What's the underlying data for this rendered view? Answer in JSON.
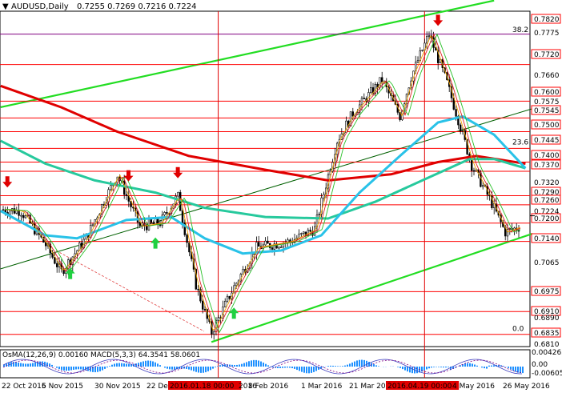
{
  "header": {
    "symbol_timeframe": "AUDUSD,Daily",
    "ohlc": "0.7255 0.7269 0.7216 0.7224"
  },
  "indicator_header": "OsMA(12,26,9) 0.00160 MACD(5,3,3) 64.3541 58.0601",
  "fib_labels": [
    {
      "text": "38.2",
      "price": 0.7822
    },
    {
      "text": "23.6",
      "price": 0.7452
    },
    {
      "text": "0.0",
      "price": 0.6841
    }
  ],
  "price_labels": [
    {
      "text": "0.7820",
      "boxed": true
    },
    {
      "text": "0.7775",
      "boxed": false
    },
    {
      "text": "0.7720",
      "boxed": true
    },
    {
      "text": "0.7660",
      "boxed": false
    },
    {
      "text": "0.7600",
      "boxed": true
    },
    {
      "text": "0.7575",
      "boxed": false
    },
    {
      "text": "0.7545",
      "boxed": true
    },
    {
      "text": "0.7500",
      "boxed": true
    },
    {
      "text": "0.7445",
      "boxed": true
    },
    {
      "text": "0.7400",
      "boxed": true
    },
    {
      "text": "0.7370",
      "boxed": true
    },
    {
      "text": "0.7320",
      "boxed": false
    },
    {
      "text": "0.7290",
      "boxed": true
    },
    {
      "text": "0.7260",
      "boxed": true
    },
    {
      "text": "0.7224",
      "boxed": false
    },
    {
      "text": "0.7200",
      "boxed": true
    },
    {
      "text": "0.7140",
      "boxed": true
    },
    {
      "text": "0.7065",
      "boxed": false
    },
    {
      "text": "0.6975",
      "boxed": true
    },
    {
      "text": "0.6910",
      "boxed": true
    },
    {
      "text": "0.6890",
      "boxed": false
    },
    {
      "text": "0.6835",
      "boxed": true
    },
    {
      "text": "0.6810",
      "boxed": false
    }
  ],
  "indicator_labels": [
    "0.004263",
    "0.00",
    "-0.00605"
  ],
  "date_labels": [
    "22 Oct 2015",
    "6 Nov 2015",
    "30 Nov 2015",
    "22 Dec 2015",
    "2016.01.18 00:00",
    "2016",
    "8 Feb 2016",
    "1 Mar 2016",
    "21 Mar 2016",
    "2016.04.19 00:00",
    "4 May 2016",
    "26 May 2016"
  ],
  "date_labels_highlighted": [
    "2016.01.18 00:00",
    "2016.04.19 00:00"
  ],
  "colors": {
    "sma200": "#e00000",
    "sma144": "#27c99d",
    "sma50": "#29c2e8",
    "fast_ma": "#e02020",
    "mid_ma": "#f0a000",
    "slow_ma": "#28c028",
    "channel": "#22dd22",
    "level_line": "#ff0000",
    "fib_line": "#800080",
    "arrow_down": "#e00000",
    "arrow_up": "#20d040",
    "osma": "#1e90ff",
    "macd_signal": "#4040c0",
    "highlight_box": "#e00000"
  },
  "chart_data": {
    "type": "candlestick",
    "symbol": "AUDUSD",
    "timeframe": "Daily",
    "last_bar": {
      "open": 0.7255,
      "high": 0.7269,
      "low": 0.7216,
      "close": 0.7224
    },
    "ylim": [
      0.6795,
      0.7895
    ],
    "horizontal_levels": [
      0.782,
      0.772,
      0.76,
      0.7545,
      0.75,
      0.7445,
      0.74,
      0.737,
      0.729,
      0.726,
      0.72,
      0.714,
      0.6975,
      0.691,
      0.6835
    ],
    "current_price": 0.7224,
    "swing_path": [
      {
        "date": "2015-10-13",
        "price": 0.7245
      },
      {
        "date": "2015-10-22",
        "price": 0.724
      },
      {
        "date": "2015-11-02",
        "price": 0.713
      },
      {
        "date": "2015-11-09",
        "price": 0.704
      },
      {
        "date": "2015-11-20",
        "price": 0.715
      },
      {
        "date": "2015-12-04",
        "price": 0.736
      },
      {
        "date": "2015-12-14",
        "price": 0.719
      },
      {
        "date": "2015-12-23",
        "price": 0.72
      },
      {
        "date": "2015-12-31",
        "price": 0.729
      },
      {
        "date": "2016-01-08",
        "price": 0.7
      },
      {
        "date": "2016-01-15",
        "price": 0.684
      },
      {
        "date": "2016-01-25",
        "price": 0.699
      },
      {
        "date": "2016-02-04",
        "price": 0.712
      },
      {
        "date": "2016-02-19",
        "price": 0.714
      },
      {
        "date": "2016-03-01",
        "price": 0.718
      },
      {
        "date": "2016-03-11",
        "price": 0.747
      },
      {
        "date": "2016-03-18",
        "price": 0.756
      },
      {
        "date": "2016-03-31",
        "price": 0.767
      },
      {
        "date": "2016-04-08",
        "price": 0.755
      },
      {
        "date": "2016-04-13",
        "price": 0.768
      },
      {
        "date": "2016-04-21",
        "price": 0.782
      },
      {
        "date": "2016-04-29",
        "price": 0.766
      },
      {
        "date": "2016-05-04",
        "price": 0.754
      },
      {
        "date": "2016-05-10",
        "price": 0.739
      },
      {
        "date": "2016-05-18",
        "price": 0.728
      },
      {
        "date": "2016-05-25",
        "price": 0.717
      },
      {
        "date": "2016-06-01",
        "price": 0.719
      },
      {
        "date": "2016-06-03",
        "price": 0.7224
      }
    ],
    "moving_averages": [
      {
        "color": "#e00000",
        "points": [
          [
            "2015-10-13",
            0.765
          ],
          [
            "2015-11-09",
            0.758
          ],
          [
            "2015-12-04",
            0.75
          ],
          [
            "2016-01-05",
            0.742
          ],
          [
            "2016-02-08",
            0.7375
          ],
          [
            "2016-03-07",
            0.734
          ],
          [
            "2016-04-04",
            0.736
          ],
          [
            "2016-04-25",
            0.74
          ],
          [
            "2016-05-12",
            0.742
          ],
          [
            "2016-06-03",
            0.7395
          ]
        ]
      },
      {
        "color": "#27c99d",
        "points": [
          [
            "2015-10-13",
            0.747
          ],
          [
            "2015-11-02",
            0.7395
          ],
          [
            "2015-11-24",
            0.734
          ],
          [
            "2015-12-21",
            0.73
          ],
          [
            "2016-01-12",
            0.725
          ],
          [
            "2016-02-08",
            0.722
          ],
          [
            "2016-03-07",
            0.7215
          ],
          [
            "2016-03-28",
            0.727
          ],
          [
            "2016-04-18",
            0.734
          ],
          [
            "2016-05-09",
            0.741
          ],
          [
            "2016-05-20",
            0.741
          ],
          [
            "2016-06-03",
            0.738
          ]
        ]
      },
      {
        "color": "#29c2e8",
        "points": [
          [
            "2015-10-13",
            0.724
          ],
          [
            "2015-11-02",
            0.716
          ],
          [
            "2015-11-16",
            0.715
          ],
          [
            "2015-12-08",
            0.721
          ],
          [
            "2015-12-28",
            0.722
          ],
          [
            "2016-01-12",
            0.715
          ],
          [
            "2016-01-29",
            0.71
          ],
          [
            "2016-02-15",
            0.711
          ],
          [
            "2016-03-04",
            0.716
          ],
          [
            "2016-03-21",
            0.73
          ],
          [
            "2016-04-08",
            0.742
          ],
          [
            "2016-04-25",
            0.753
          ],
          [
            "2016-05-06",
            0.755
          ],
          [
            "2016-05-20",
            0.749
          ],
          [
            "2016-06-03",
            0.738
          ]
        ]
      }
    ],
    "trend_channel": {
      "upper": [
        [
          "2015-10-13",
          0.758
        ],
        [
          "2016-05-20",
          0.793
        ]
      ],
      "lower": [
        [
          "2016-01-15",
          0.681
        ],
        [
          "2016-06-06",
          0.7165
        ]
      ],
      "middle": [
        [
          "2015-10-13",
          0.705
        ],
        [
          "2016-06-06",
          0.7575
        ]
      ]
    },
    "signals": {
      "sell": [
        [
          "2015-10-16",
          0.733
        ],
        [
          "2015-12-09",
          0.735
        ],
        [
          "2015-12-31",
          0.736
        ],
        [
          "2016-04-25",
          0.786
        ]
      ],
      "buy": [
        [
          "2015-11-13",
          0.704
        ],
        [
          "2015-12-21",
          0.714
        ],
        [
          "2016-01-25",
          0.691
        ]
      ]
    },
    "fibonacci": [
      {
        "level": "38.2",
        "price": 0.7822
      },
      {
        "level": "23.6",
        "price": 0.7452
      },
      {
        "level": "0.0",
        "price": 0.6841
      }
    ],
    "vertical_markers": [
      "2016-01-18",
      "2016-04-19"
    ],
    "indicator": {
      "name": "OsMA(12,26,9)",
      "osma_last": 0.0016,
      "macd_name": "MACD(5,3,3)",
      "macd_values": [
        64.3541,
        58.0601
      ],
      "ylim": [
        -0.00605,
        0.004263
      ]
    }
  }
}
